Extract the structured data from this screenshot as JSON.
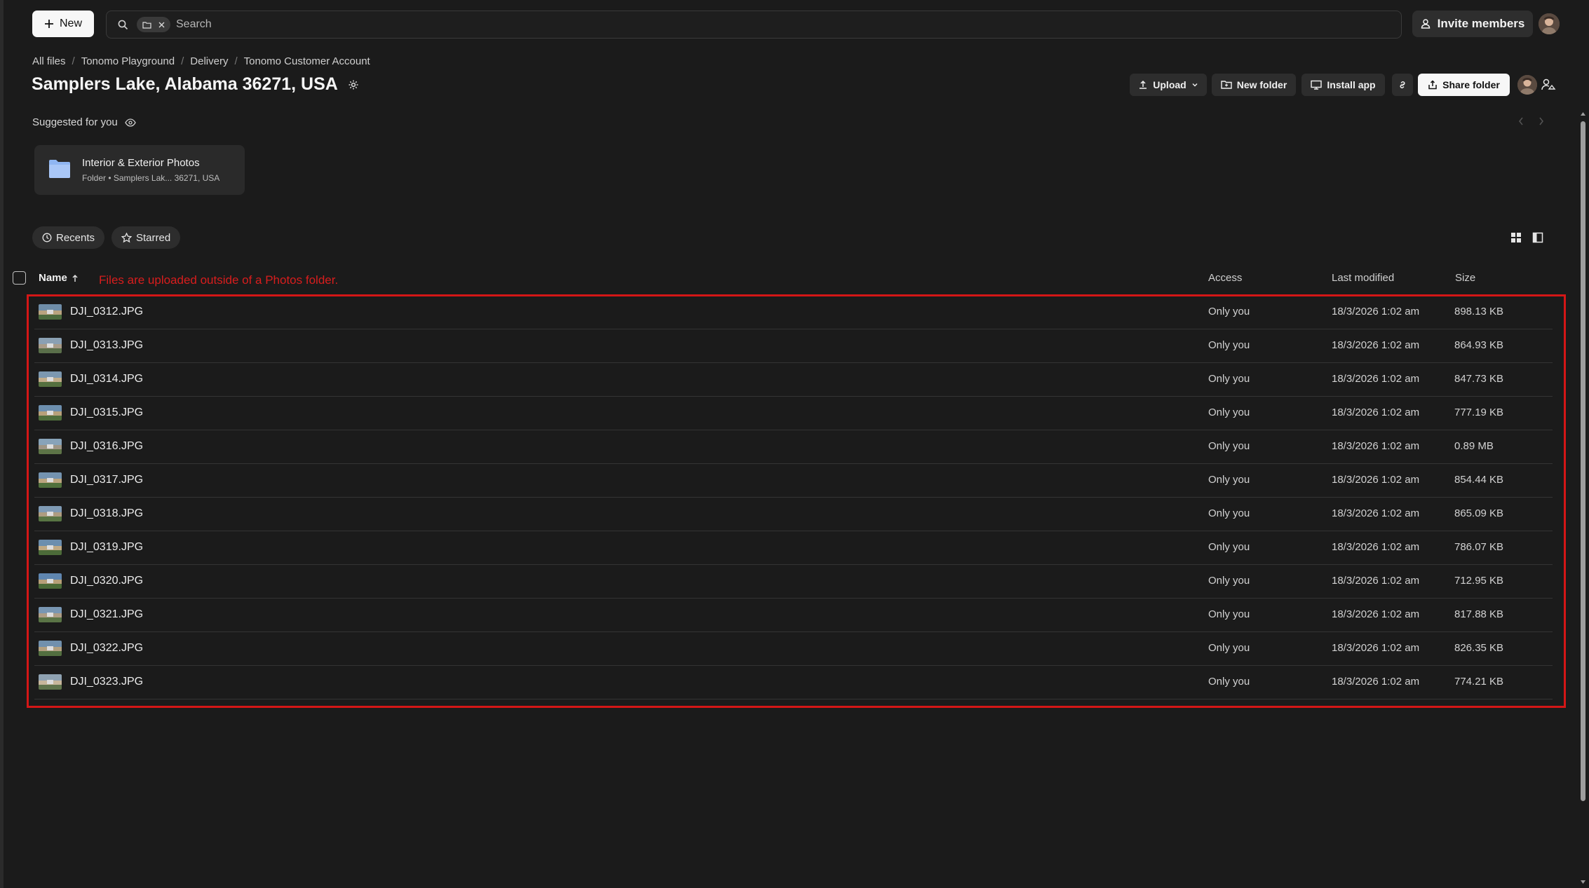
{
  "toolbar": {
    "new_label": "New",
    "search_placeholder": "Search",
    "invite_label": "Invite members"
  },
  "breadcrumb": [
    "All files",
    "Tonomo Playground",
    "Delivery",
    "Tonomo Customer Account"
  ],
  "page_title": "Samplers Lake, Alabama 36271, USA",
  "actions": {
    "upload": "Upload",
    "new_folder": "New folder",
    "install_app": "Install app",
    "share_folder": "Share folder"
  },
  "suggested": {
    "label": "Suggested for you",
    "card_name": "Interior & Exterior Photos",
    "card_meta": "Folder • Samplers Lak... 36271, USA"
  },
  "filters": {
    "recents": "Recents",
    "starred": "Starred"
  },
  "table": {
    "col_name": "Name",
    "col_access": "Access",
    "col_modified": "Last modified",
    "col_size": "Size",
    "annotation": "Files are uploaded outside of a Photos folder.",
    "rows": [
      {
        "name": "DJI_0312.JPG",
        "access": "Only you",
        "modified": "18/3/2026 1:02 am",
        "size": "898.13 KB"
      },
      {
        "name": "DJI_0313.JPG",
        "access": "Only you",
        "modified": "18/3/2026 1:02 am",
        "size": "864.93 KB"
      },
      {
        "name": "DJI_0314.JPG",
        "access": "Only you",
        "modified": "18/3/2026 1:02 am",
        "size": "847.73 KB"
      },
      {
        "name": "DJI_0315.JPG",
        "access": "Only you",
        "modified": "18/3/2026 1:02 am",
        "size": "777.19 KB"
      },
      {
        "name": "DJI_0316.JPG",
        "access": "Only you",
        "modified": "18/3/2026 1:02 am",
        "size": "0.89 MB"
      },
      {
        "name": "DJI_0317.JPG",
        "access": "Only you",
        "modified": "18/3/2026 1:02 am",
        "size": "854.44 KB"
      },
      {
        "name": "DJI_0318.JPG",
        "access": "Only you",
        "modified": "18/3/2026 1:02 am",
        "size": "865.09 KB"
      },
      {
        "name": "DJI_0319.JPG",
        "access": "Only you",
        "modified": "18/3/2026 1:02 am",
        "size": "786.07 KB"
      },
      {
        "name": "DJI_0320.JPG",
        "access": "Only you",
        "modified": "18/3/2026 1:02 am",
        "size": "712.95 KB"
      },
      {
        "name": "DJI_0321.JPG",
        "access": "Only you",
        "modified": "18/3/2026 1:02 am",
        "size": "817.88 KB"
      },
      {
        "name": "DJI_0322.JPG",
        "access": "Only you",
        "modified": "18/3/2026 1:02 am",
        "size": "826.35 KB"
      },
      {
        "name": "DJI_0323.JPG",
        "access": "Only you",
        "modified": "18/3/2026 1:02 am",
        "size": "774.21 KB"
      }
    ]
  },
  "colors": {
    "background": "#1b1b1b",
    "annotation_red": "#d41616",
    "folder_blue": "#8fb6f2"
  },
  "icons": [
    "plus-icon",
    "search-icon",
    "folder-icon",
    "close-icon",
    "person-add-icon",
    "upload-icon",
    "chevron-down-icon",
    "new-folder-icon",
    "monitor-icon",
    "link-icon",
    "share-icon",
    "settings-icon",
    "eye-icon",
    "clock-icon",
    "star-icon",
    "sort-arrow-up-icon",
    "grid-view-icon",
    "panel-view-icon"
  ]
}
